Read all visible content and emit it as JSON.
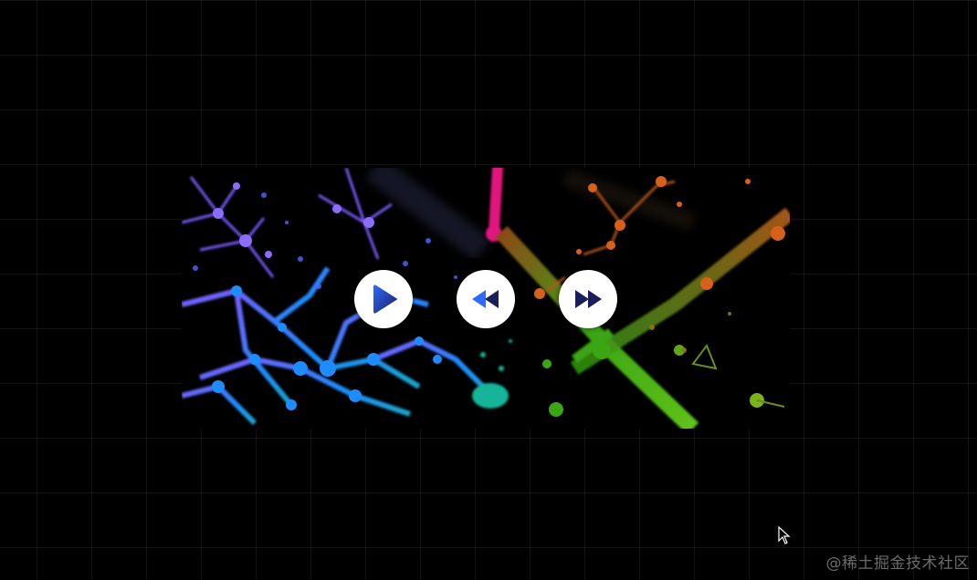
{
  "video": {
    "buttons": {
      "play": {
        "icon": "play-icon"
      },
      "rewind": {
        "icon": "rewind-icon"
      },
      "forward": {
        "icon": "fast-forward-icon"
      }
    },
    "colors": {
      "background": "#000000",
      "button_bg": "#ffffff",
      "icon_light": "#2f6bff",
      "icon_dark": "#1a1f5c",
      "art_violet": "#7c5cff",
      "art_blue": "#1e8bff",
      "art_magenta": "#e0197d",
      "art_orange": "#d6611c",
      "art_green": "#2fae13"
    }
  },
  "watermark": {
    "text": "@稀土掘金技术社区"
  }
}
